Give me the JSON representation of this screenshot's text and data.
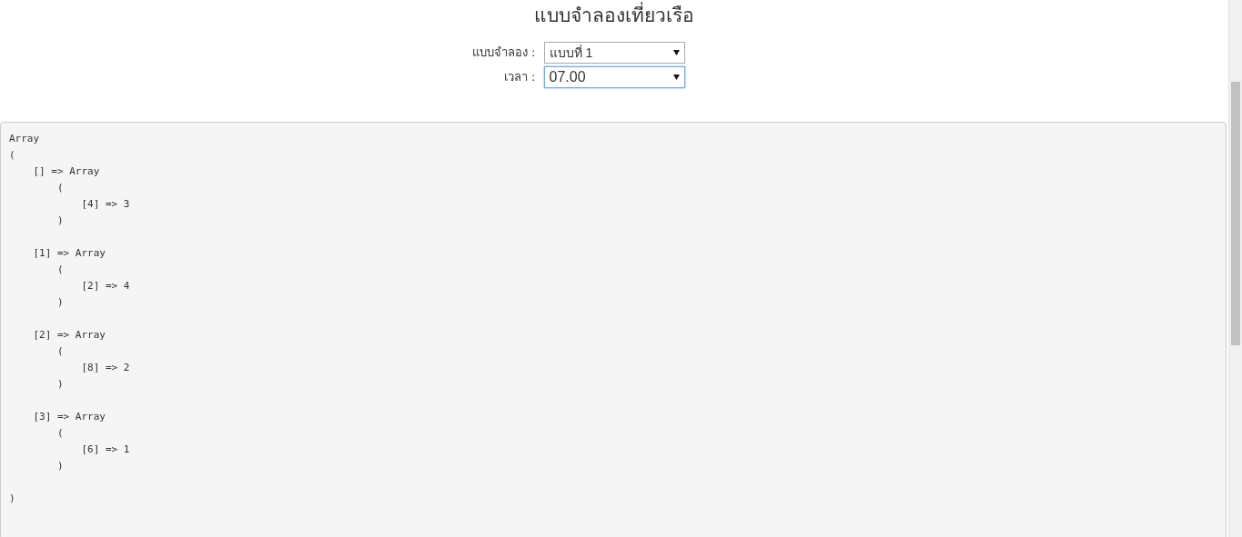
{
  "title": "แบบจำลองเที่ยวเรือ",
  "fields": [
    {
      "label": "แบบจำลอง :",
      "value": "แบบที่ 1",
      "focused": false
    },
    {
      "label": "เวลา :",
      "value": "07.00",
      "focused": true
    }
  ],
  "output": "Array\n(\n    [] => Array\n        (\n            [4] => 3\n        )\n\n    [1] => Array\n        (\n            [2] => 4\n        )\n\n    [2] => Array\n        (\n            [8] => 2\n        )\n\n    [3] => Array\n        (\n            [6] => 1\n        )\n\n)"
}
